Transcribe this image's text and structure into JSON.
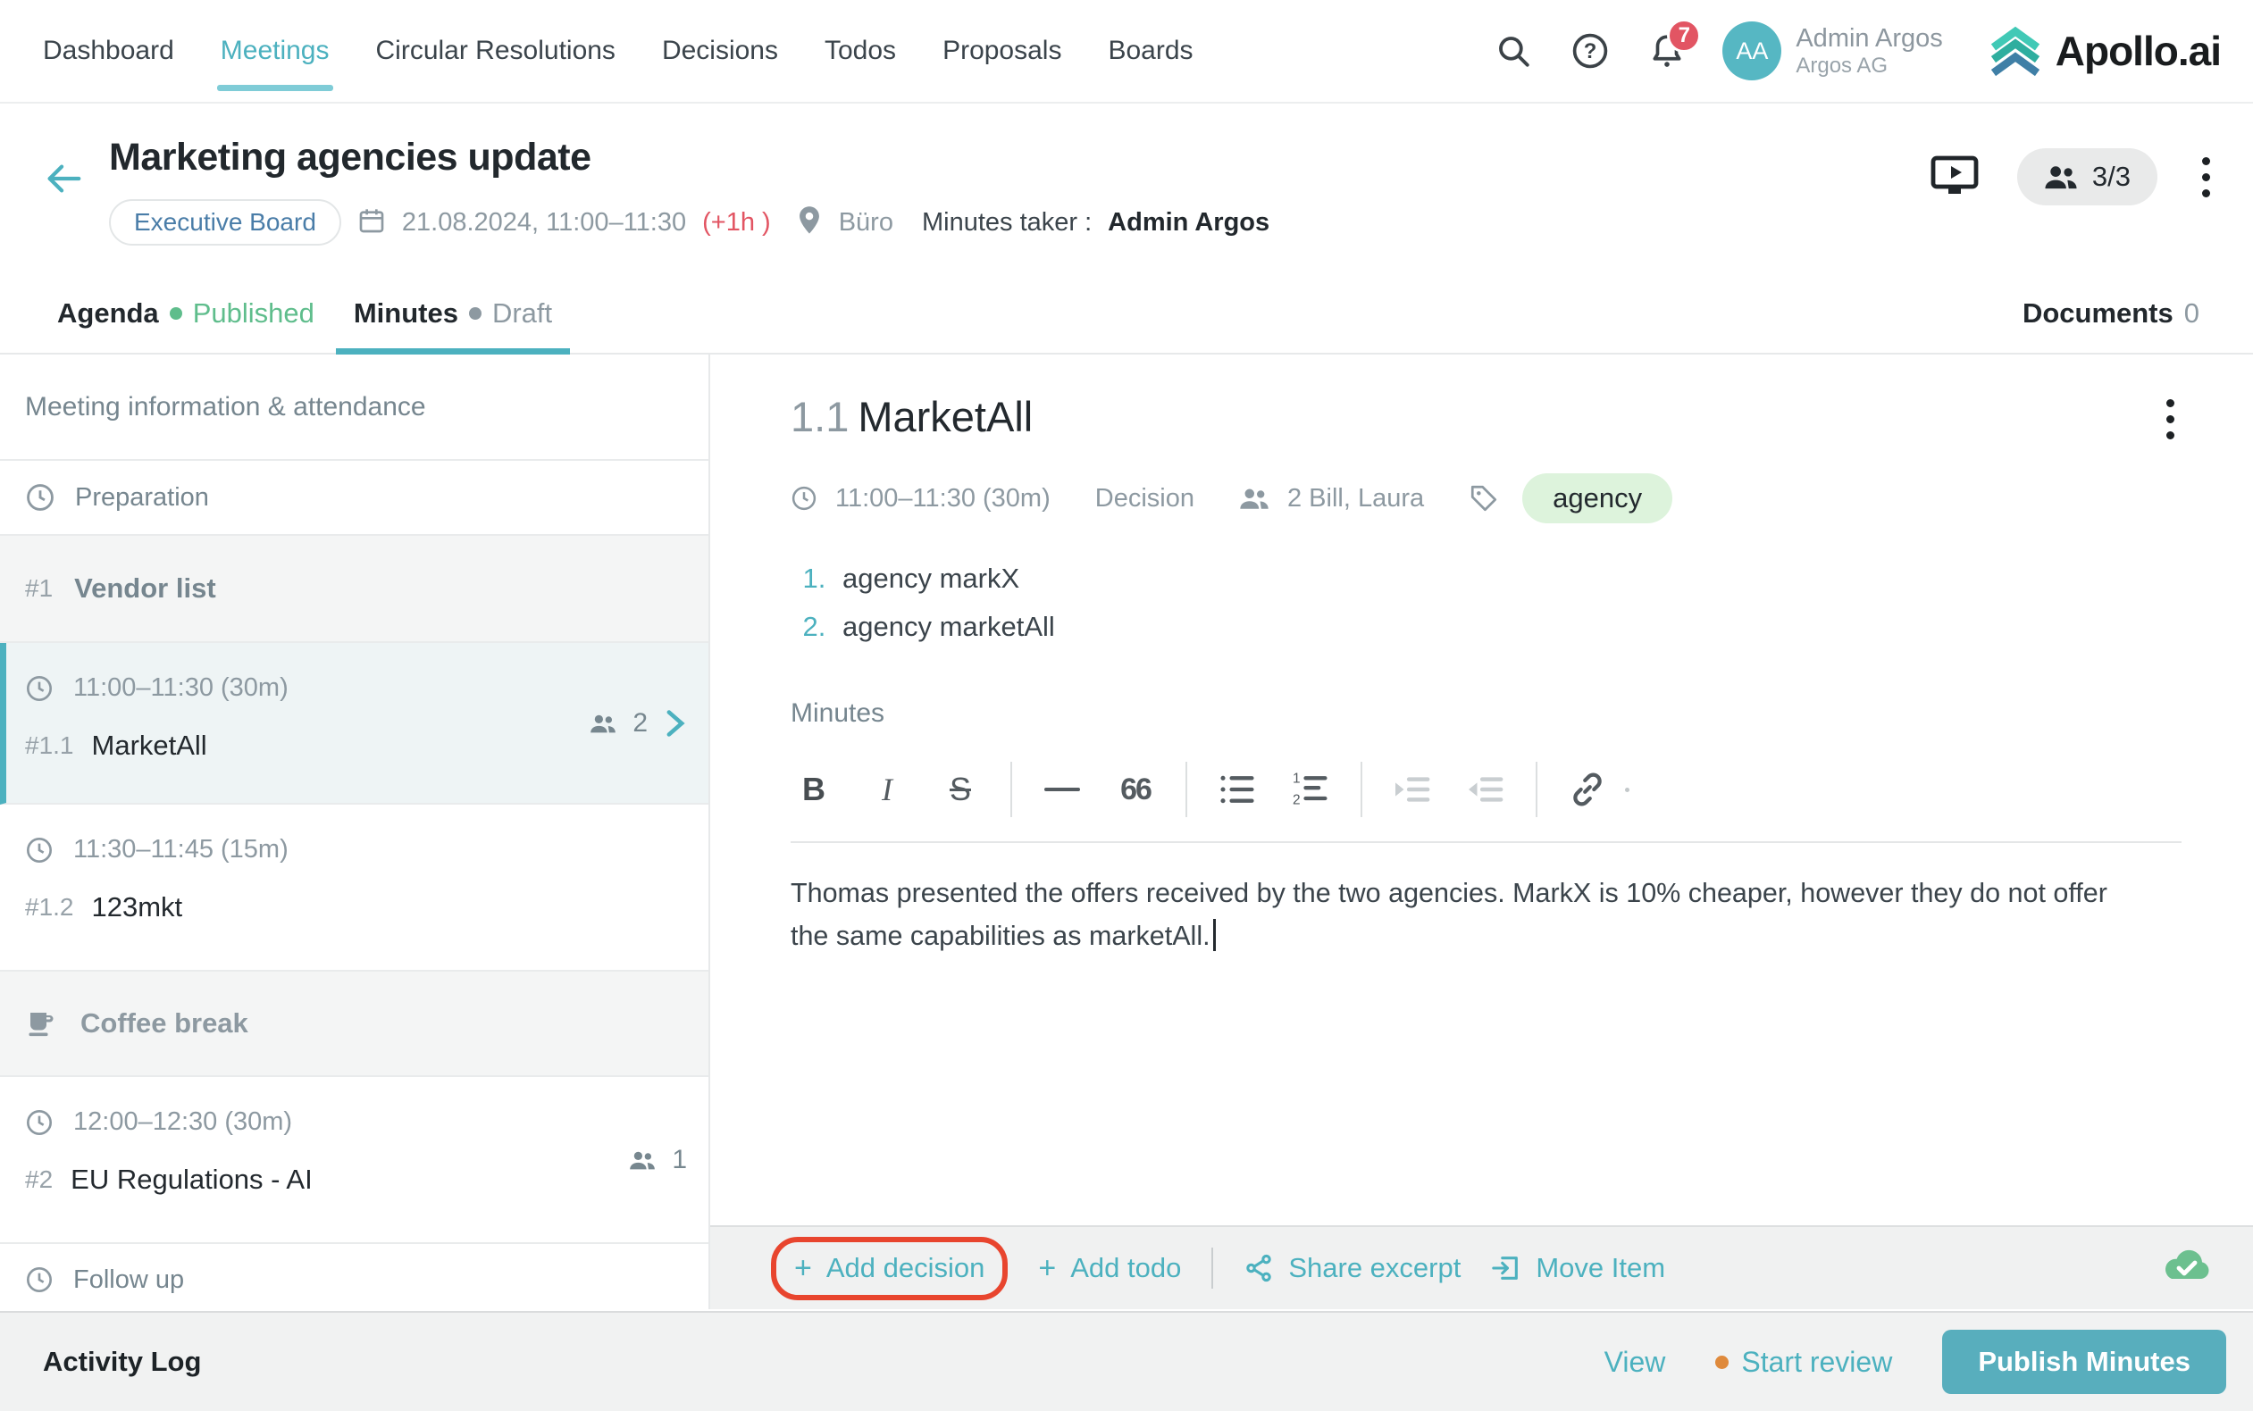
{
  "topnav": {
    "items": [
      {
        "label": "Dashboard"
      },
      {
        "label": "Meetings"
      },
      {
        "label": "Circular Resolutions"
      },
      {
        "label": "Decisions"
      },
      {
        "label": "Todos"
      },
      {
        "label": "Proposals"
      },
      {
        "label": "Boards"
      }
    ],
    "notification_count": "7",
    "avatar_initials": "AA",
    "user_name": "Admin Argos",
    "org_name": "Argos AG",
    "brand": "Apollo.ai",
    "icons": [
      "search-icon",
      "help-icon",
      "bell-icon"
    ]
  },
  "header": {
    "title": "Marketing agencies update",
    "board_badge": "Executive Board",
    "datetime": "21.08.2024, 11:00–11:30",
    "overtime": "(+1h )",
    "location": "Büro",
    "minutes_taker_label": "Minutes taker :",
    "minutes_taker": "Admin Argos",
    "attendance": "3/3",
    "icons": [
      "presentation-icon",
      "people-icon",
      "kebab-menu-icon",
      "back-arrow-icon",
      "calendar-icon",
      "location-pin-icon"
    ]
  },
  "tabs": {
    "agenda_label": "Agenda",
    "agenda_status": "Published",
    "minutes_label": "Minutes",
    "minutes_status": "Draft",
    "documents_label": "Documents",
    "documents_count": "0"
  },
  "sidebar": {
    "meeting_info": "Meeting information & attendance",
    "preparation": "Preparation",
    "vendor": {
      "number": "#1",
      "title": "Vendor list"
    },
    "item_1_1": {
      "time": "11:00–11:30 (30m)",
      "number": "#1.1",
      "title": "MarketAll",
      "attendees": "2"
    },
    "item_1_2": {
      "time": "11:30–11:45 (15m)",
      "number": "#1.2",
      "title": "123mkt"
    },
    "coffee_break": "Coffee break",
    "item_2": {
      "time": "12:00–12:30 (30m)",
      "number": "#2",
      "title": "EU Regulations - AI",
      "attendees": "1"
    },
    "follow_up": "Follow up"
  },
  "main": {
    "item_number": "1.1",
    "item_title": "MarketAll",
    "time": "11:00–11:30 (30m)",
    "type": "Decision",
    "attendees": "2 Bill, Laura",
    "tag": "agency",
    "list": [
      "agency markX",
      "agency marketAll"
    ],
    "minutes_label": "Minutes",
    "toolbar": {
      "bold": "B",
      "italic": "I",
      "strike": "S",
      "rule": "—",
      "quote": "66"
    },
    "paragraph": "Thomas presented the offers received by the two agencies. MarkX is 10% cheaper, however they do not offer the same capabilities as marketAll.",
    "actions": {
      "add_decision": "Add decision",
      "add_todo": "Add todo",
      "share_excerpt": "Share excerpt",
      "move_item": "Move Item"
    }
  },
  "footer": {
    "activity_log": "Activity Log",
    "view": "View",
    "start_review": "Start review",
    "publish": "Publish Minutes"
  },
  "colors": {
    "accent_teal": "#4cb1bf",
    "green": "#5fbd8c",
    "tag_bg": "#ddf3dc",
    "red": "#e25563",
    "annotation_red": "#e8452e",
    "orange": "#df8a3c"
  }
}
